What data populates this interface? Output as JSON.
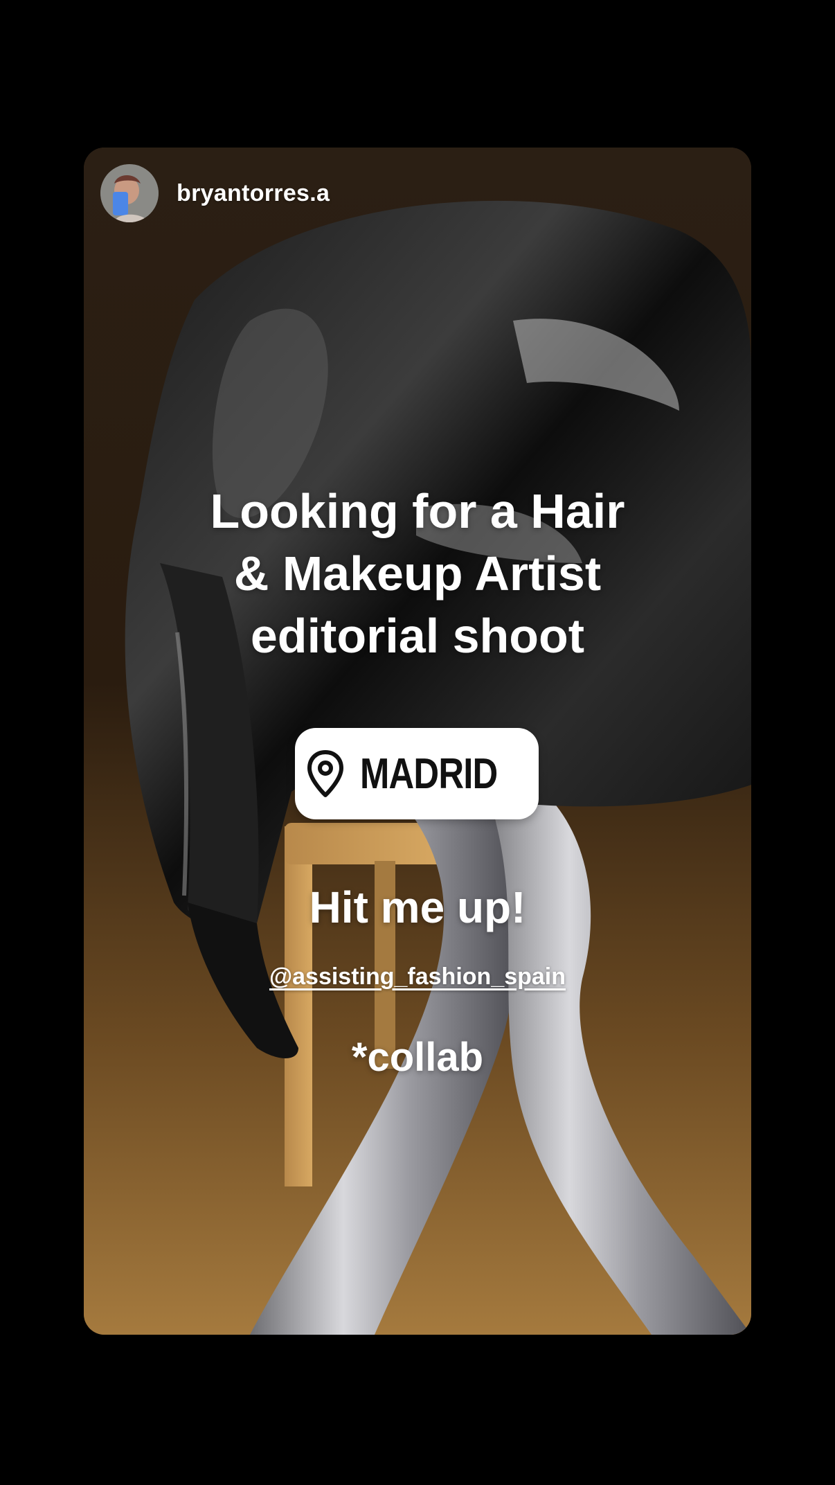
{
  "story": {
    "username": "bryantorres.a",
    "headline_lines": [
      "Looking for a Hair",
      "& Makeup Artist",
      "editorial shoot"
    ],
    "location": {
      "icon": "location-pin-icon",
      "label": "MADRID"
    },
    "cta": "Hit me up!",
    "mention": "@assisting_fashion_spain",
    "note": "*collab"
  },
  "colors": {
    "background": "#000000",
    "sticker_bg": "#ffffff",
    "text_primary": "#ffffff",
    "sticker_text": "#111111"
  }
}
